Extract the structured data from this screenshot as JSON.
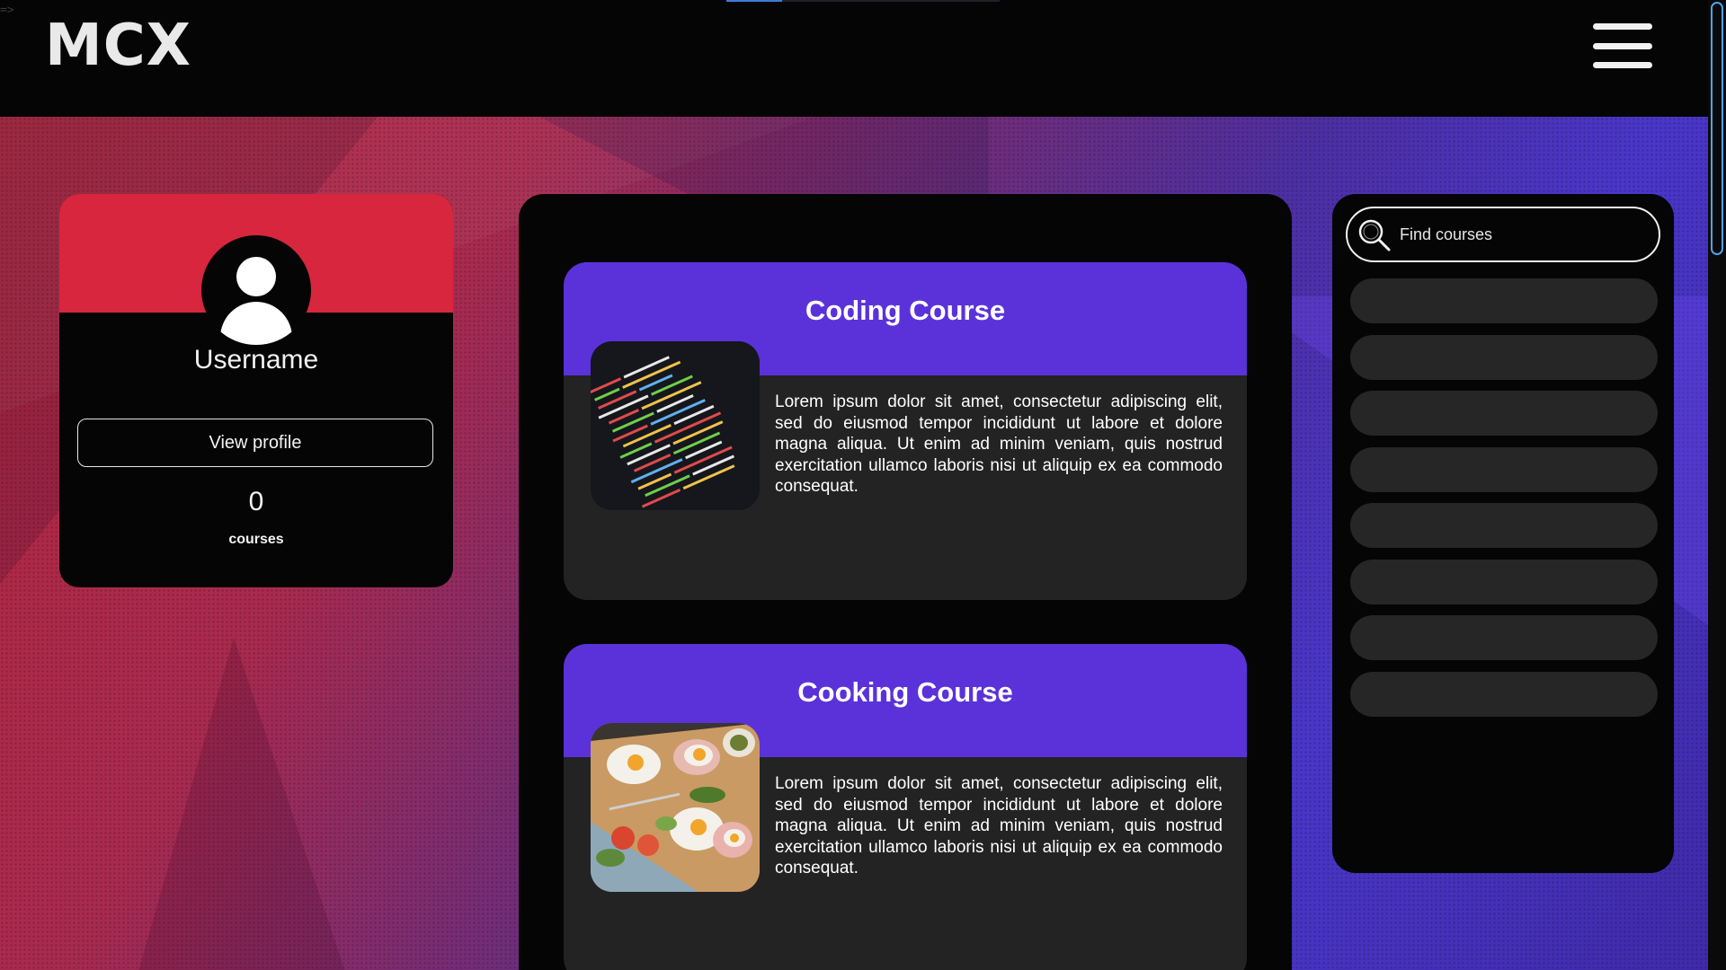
{
  "header": {
    "logo": "MCX",
    "corner_mark": "=>"
  },
  "profile": {
    "username": "Username",
    "view_profile_label": "View profile",
    "course_count": "0",
    "course_count_label": "courses"
  },
  "courses": [
    {
      "title": "Coding Course",
      "description": "Lorem ipsum dolor sit amet, consectetur adipiscing elit, sed do eiusmod tempor incididunt ut labore et dolore magna aliqua. Ut enim ad minim veniam, quis nostrud exercitation ullamco laboris nisi ut aliquip ex ea commodo consequat.",
      "thumbnail": "code-screenshot"
    },
    {
      "title": "Cooking Course",
      "description": "Lorem ipsum dolor sit amet, consectetur adipiscing elit, sed do eiusmod tempor incididunt ut labore et dolore magna aliqua. Ut enim ad minim veniam, quis nostrud exercitation ullamco laboris nisi ut aliquip ex ea commodo consequat.",
      "thumbnail": "food-plate"
    }
  ],
  "search": {
    "placeholder": "Find courses",
    "result_slots": 8
  },
  "icons": {
    "menu": "hamburger-menu-icon",
    "search": "magnifier-icon",
    "avatar": "user-silhouette-icon"
  },
  "colors": {
    "accent_red": "#d7263d",
    "accent_purple": "#5b32d9",
    "panel": "#050505",
    "card": "#232323",
    "scroll_accent": "#4da3e8"
  }
}
